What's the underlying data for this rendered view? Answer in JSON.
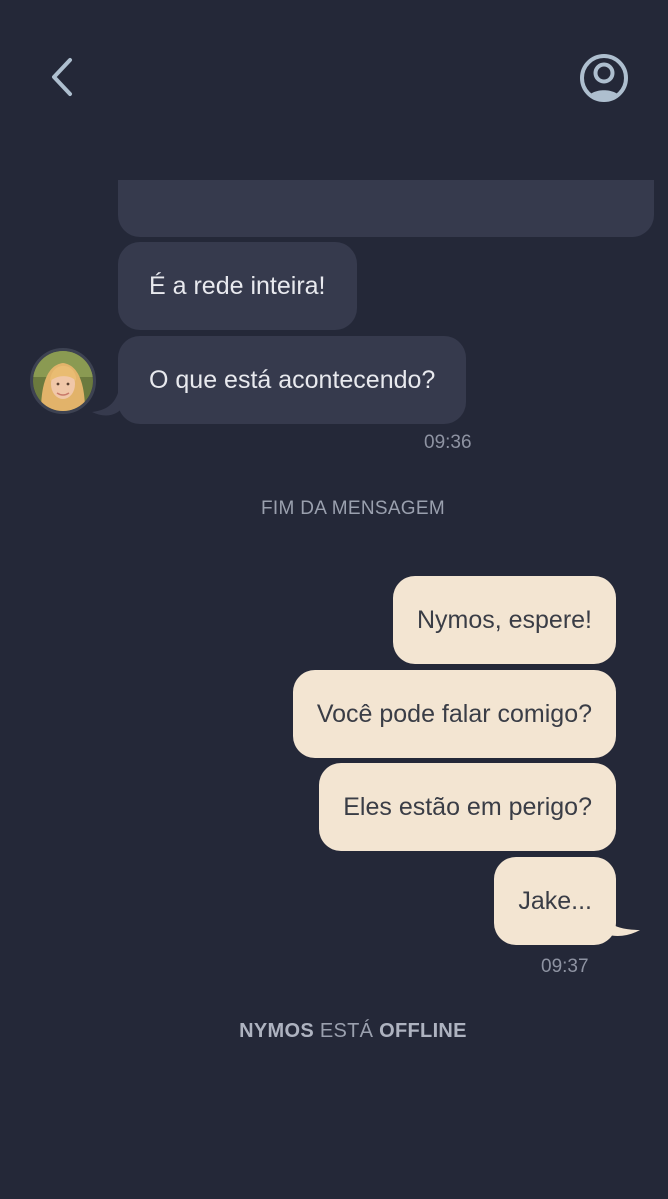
{
  "header": {
    "back_icon": "chevron-left-icon",
    "profile_icon": "user-circle-icon"
  },
  "incoming": [
    {
      "text": "É a rede inteira!"
    },
    {
      "text": "O que está acontecendo?"
    }
  ],
  "incoming_time": "09:36",
  "end_notice": "FIM DA MENSAGEM",
  "outgoing": [
    {
      "text": "Nymos, espere!"
    },
    {
      "text": "Você pode falar comigo?"
    },
    {
      "text": "Eles estão em perigo?"
    },
    {
      "text": "Jake..."
    }
  ],
  "outgoing_time": "09:37",
  "status": {
    "name": "NYMOS",
    "middle": "ESTÁ",
    "state": "OFFLINE"
  },
  "colors": {
    "background": "#242838",
    "incoming_bubble": "#363a4d",
    "outgoing_bubble": "#f3e5d2"
  }
}
